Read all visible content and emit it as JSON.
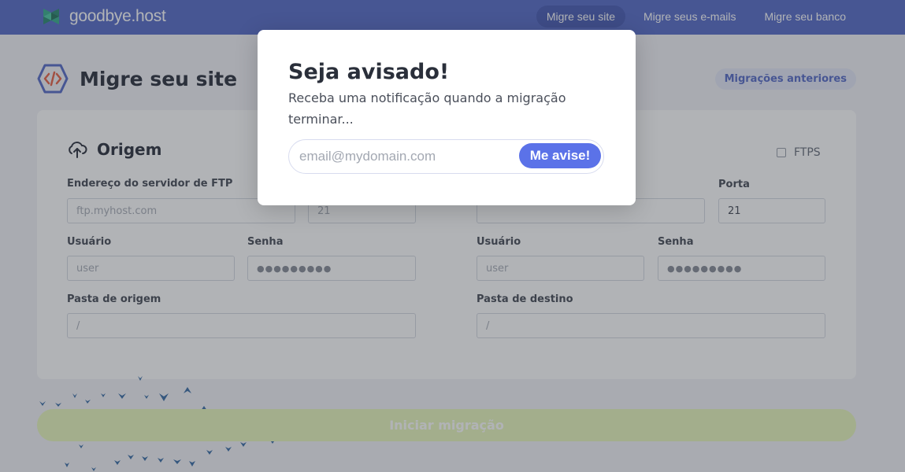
{
  "app": {
    "logo_text": "goodbye.host"
  },
  "nav": {
    "items": [
      {
        "label": "Migre seu site",
        "active": true
      },
      {
        "label": "Migre seus e-mails",
        "active": false
      },
      {
        "label": "Migre seu banco",
        "active": false
      }
    ]
  },
  "page": {
    "title": "Migre seu site",
    "previous_migrations_label": "Migrações anteriores"
  },
  "origin": {
    "title": "Origem",
    "ftp_server_label": "Endereço do servidor de FTP",
    "ftp_server_placeholder": "ftp.myhost.com",
    "port_value": "21",
    "user_label": "Usuário",
    "user_placeholder": "user",
    "password_label": "Senha",
    "password_dots": "●●●●●●●●●",
    "folder_label": "Pasta de origem",
    "folder_placeholder": "/"
  },
  "destination": {
    "ftps_label": "FTPS",
    "port_label": "Porta",
    "port_value": "21",
    "user_label": "Usuário",
    "user_placeholder": "user",
    "password_label": "Senha",
    "password_dots": "●●●●●●●●●",
    "folder_label": "Pasta de destino",
    "folder_placeholder": "/"
  },
  "start_button_label": "Iniciar migração",
  "modal": {
    "title": "Seja avisado!",
    "description": "Receba uma notificação quando a migração terminar...",
    "email_placeholder": "email@mydomain.com",
    "email_value": "",
    "button_label": "Me avise!"
  },
  "colors": {
    "brand": "#5a6ec9",
    "button_accent": "#5b72e8",
    "start_button": "#e9f8bd",
    "birds": "#3d6fa8"
  }
}
